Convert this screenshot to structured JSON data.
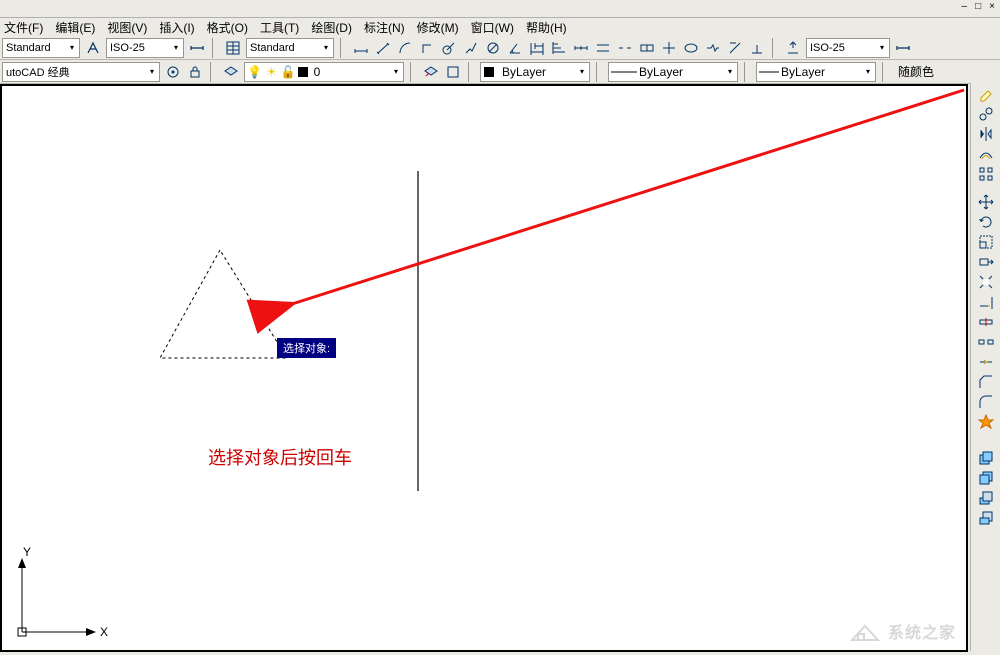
{
  "window_controls": {
    "min": "–",
    "restore": "□",
    "close": "×"
  },
  "menu": {
    "file": "文件(F)",
    "edit": "编辑(E)",
    "view": "视图(V)",
    "insert": "插入(I)",
    "format": "格式(O)",
    "tools": "工具(T)",
    "draw": "绘图(D)",
    "dimension": "标注(N)",
    "modify": "修改(M)",
    "window": "窗口(W)",
    "help": "帮助(H)"
  },
  "row1": {
    "style1": "Standard",
    "iso1": "ISO-25",
    "style2": "Standard",
    "iso2": "ISO-25"
  },
  "row2": {
    "workspace": "utoCAD 经典",
    "layer_label": "0",
    "current_layer_prop": "ByLayer",
    "linetype": "ByLayer",
    "lineweight": "ByLayer",
    "color_mode": "随颜色"
  },
  "canvas": {
    "tooltip": "选择对象:",
    "instruction": "选择对象后按回车",
    "axis_y": "Y",
    "axis_x": "X"
  },
  "watermark": "系统之家"
}
